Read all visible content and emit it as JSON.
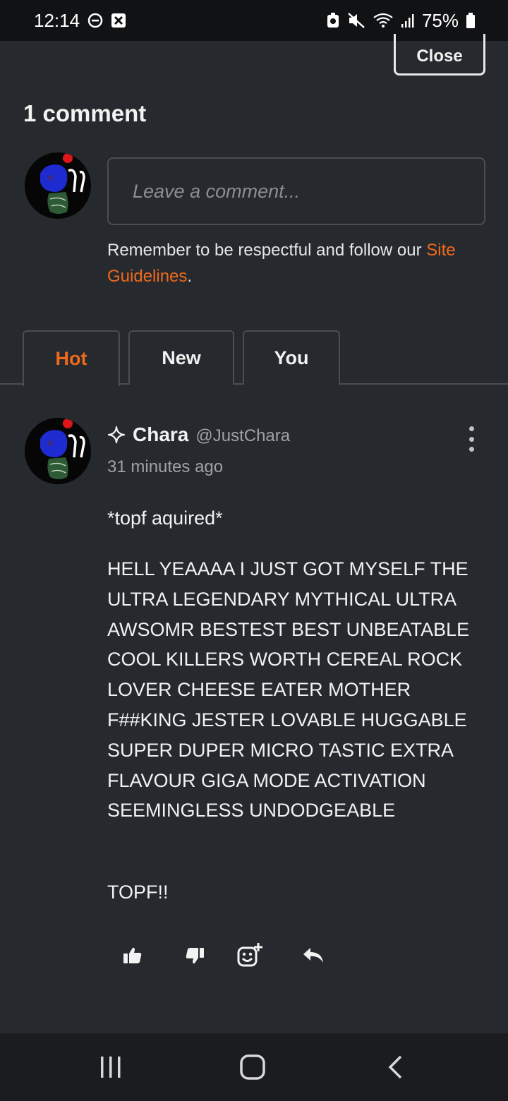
{
  "status_bar": {
    "time": "12:14",
    "battery": "75%"
  },
  "header": {
    "close_label": "Close",
    "comment_count": "1 comment"
  },
  "composer": {
    "placeholder": "Leave a comment...",
    "guidelines_text": "Remember to be respectful and follow our ",
    "guidelines_link": "Site Guidelines",
    "guidelines_end": "."
  },
  "tabs": [
    {
      "label": "Hot",
      "active": true
    },
    {
      "label": "New",
      "active": false
    },
    {
      "label": "You",
      "active": false
    }
  ],
  "comment": {
    "author": "Chara",
    "handle": "@JustChara",
    "time": "31 minutes ago",
    "paragraphs": [
      "*topf aquired*",
      "HELL YEAAAA I JUST GOT MYSELF THE ULTRA LEGENDARY MYTHICAL ULTRA AWSOMR BESTEST BEST UNBEATABLE COOL KILLERS WORTH CEREAL ROCK LOVER CHEESE EATER MOTHER F##KING JESTER LOVABLE HUGGABLE SUPER DUPER MICRO TASTIC EXTRA FLAVOUR GIGA MODE ACTIVATION SEEMINGLESS UNDODGEABLE",
      "TOPF!!"
    ]
  },
  "colors": {
    "accent": "#f06a1c",
    "background": "#26292d"
  }
}
